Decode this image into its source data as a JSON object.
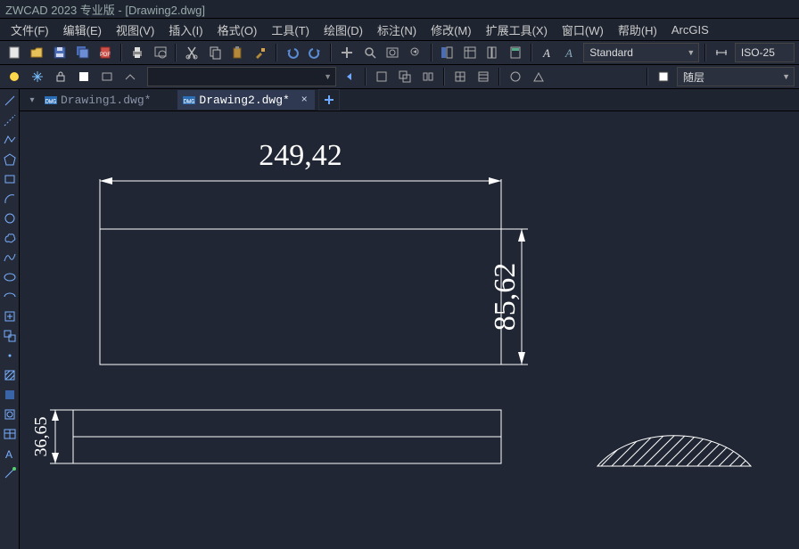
{
  "title": "ZWCAD 2023 专业版 - [Drawing2.dwg]",
  "menu": [
    "文件(F)",
    "编辑(E)",
    "视图(V)",
    "插入(I)",
    "格式(O)",
    "工具(T)",
    "绘图(D)",
    "标注(N)",
    "修改(M)",
    "扩展工具(X)",
    "窗口(W)",
    "帮助(H)",
    "ArcGIS"
  ],
  "style_dropdown": "Standard",
  "dim_style_dropdown": "ISO-25",
  "layer_dropdown": "随层",
  "tabs": [
    {
      "label": "Drawing1.dwg*",
      "active": false
    },
    {
      "label": "Drawing2.dwg*",
      "active": true
    }
  ],
  "dimensions": {
    "top_width": "249,42",
    "right_height": "85,62",
    "left_small_height": "36,65"
  }
}
